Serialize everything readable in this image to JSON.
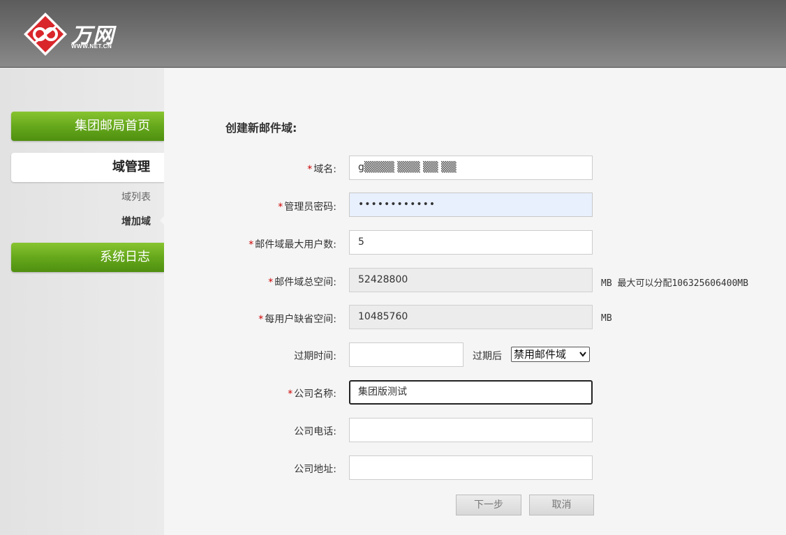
{
  "brand": {
    "name": "万网",
    "sub": "WWW.NET.CN"
  },
  "sidebar": {
    "nav_home": "集团邮局首页",
    "nav_domain": "域管理",
    "sub_list": "域列表",
    "sub_add": "增加域",
    "nav_log": "系统日志"
  },
  "form": {
    "title": "创建新邮件域:",
    "required_mark": "*",
    "domain": {
      "label": "域名:",
      "value": "g▒▒▒▒ ▒▒▒ ▒▒ ▒▒"
    },
    "password": {
      "label": "管理员密码:",
      "value": "••••••••••••"
    },
    "max_users": {
      "label": "邮件域最大用户数:",
      "value": "5"
    },
    "total_space": {
      "label": "邮件域总空间:",
      "value": "52428800",
      "note": "MB 最大可以分配106325606400MB"
    },
    "default_space": {
      "label": "每用户缺省空间:",
      "value": "10485760",
      "note": "MB"
    },
    "expire": {
      "label": "过期时间:",
      "value": "",
      "after_label": "过期后",
      "select_value": "禁用邮件域"
    },
    "company": {
      "label": "公司名称:",
      "value": "集团版测试"
    },
    "phone": {
      "label": "公司电话:",
      "value": ""
    },
    "address": {
      "label": "公司地址:",
      "value": ""
    },
    "next_button": "下一步",
    "cancel_button": "取消"
  },
  "colors": {
    "nav_green": "#66a81c",
    "required": "#cc0000",
    "logo_red": "#d9262b"
  },
  "icons": {
    "logo": "wanwang-logo-icon",
    "select_arrow": "chevron-down-icon"
  }
}
